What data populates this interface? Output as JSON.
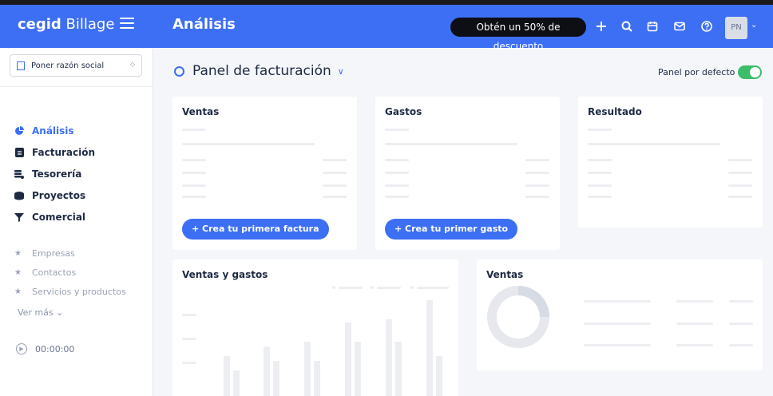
{
  "brand": {
    "name_bold": "cegid",
    "name_rest": " Billage"
  },
  "header": {
    "title": "Análisis",
    "promo": "Obtén un 50% de descuento",
    "icons": [
      "plus-icon",
      "search-icon",
      "calendar-icon",
      "mail-icon",
      "help-icon"
    ],
    "avatar_initials": "PN"
  },
  "sidebar": {
    "company_select": "Poner razón social",
    "nav": [
      {
        "label": "Análisis",
        "icon": "pie-chart-icon",
        "active": true
      },
      {
        "label": "Facturación",
        "icon": "invoice-icon",
        "active": false
      },
      {
        "label": "Tesorería",
        "icon": "coins-icon",
        "active": false
      },
      {
        "label": "Proyectos",
        "icon": "projects-icon",
        "active": false
      },
      {
        "label": "Comercial",
        "icon": "funnel-icon",
        "active": false
      }
    ],
    "favorites": [
      {
        "label": "Empresas"
      },
      {
        "label": "Contactos"
      },
      {
        "label": "Servicios y productos"
      }
    ],
    "see_more": "Ver más",
    "timer": "00:00:00"
  },
  "main": {
    "panel_title": "Panel de facturación",
    "default_panel_label": "Panel por defecto",
    "default_panel_on": true,
    "cards": {
      "sales": {
        "title": "Ventas",
        "cta": "+ Crea tu primera factura"
      },
      "expenses": {
        "title": "Gastos",
        "cta": "+ Crea tu primer gasto"
      },
      "result": {
        "title": "Resultado"
      },
      "sales_expenses": {
        "title": "Ventas y gastos"
      },
      "sales_donut": {
        "title": "Ventas"
      }
    }
  },
  "colors": {
    "brand_blue": "#3d6ff5",
    "toggle_green": "#3dbd6a",
    "promo_black": "#0d0f14"
  }
}
